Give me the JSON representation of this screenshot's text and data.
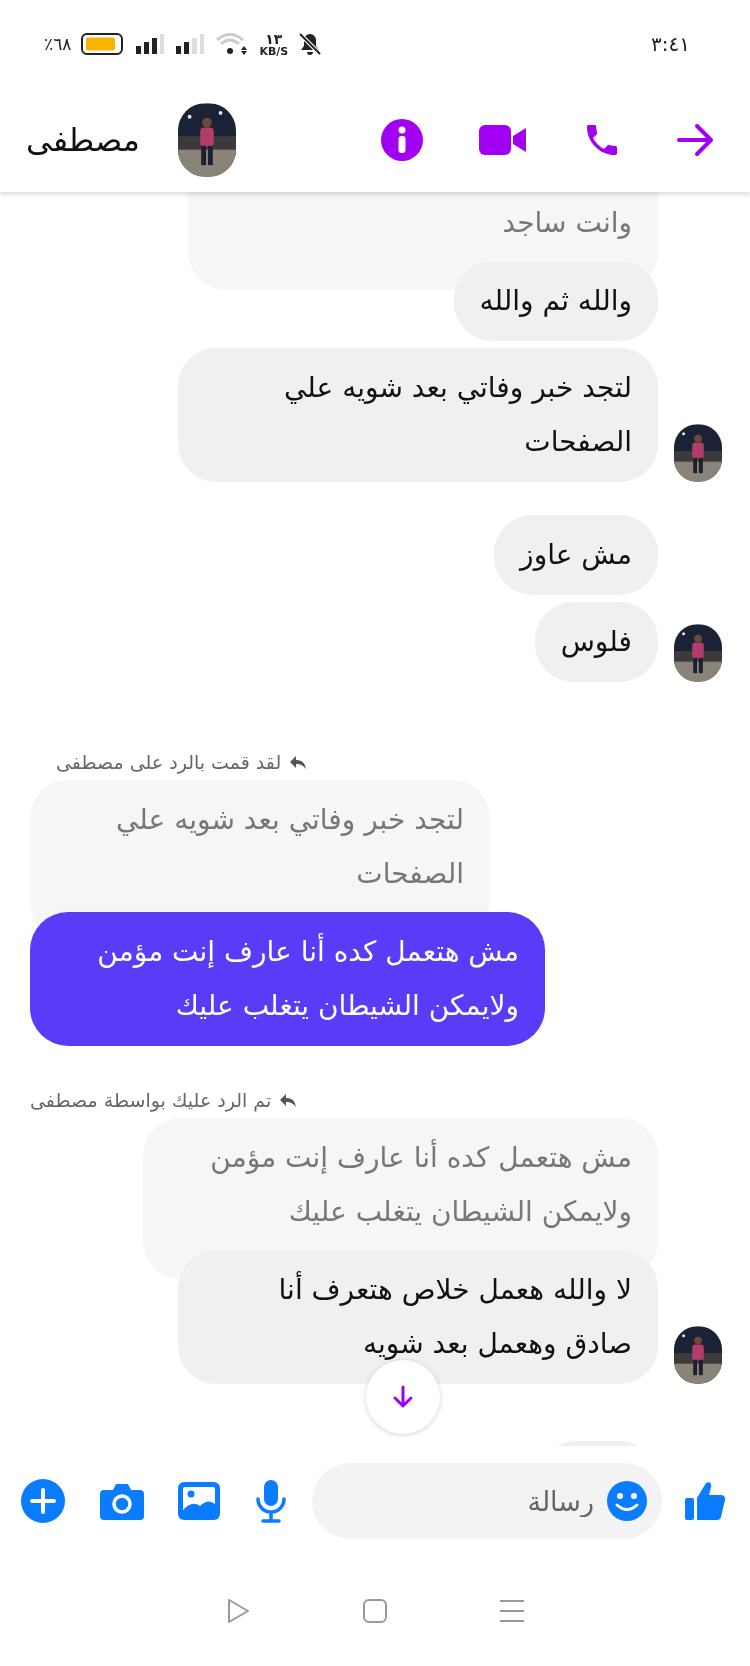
{
  "status_bar": {
    "time": "٣:٤١",
    "battery_text": "٪٦٨",
    "net_speed": "١٣",
    "net_unit": "KB/S"
  },
  "header": {
    "name": "مصطفى"
  },
  "messages": [
    {
      "kind": "quoted",
      "outgoing": false,
      "avatar": false,
      "text": "وانت ساجد"
    },
    {
      "kind": "message",
      "outgoing": false,
      "avatar": false,
      "text": "والله ثم والله"
    },
    {
      "kind": "message",
      "outgoing": false,
      "avatar": true,
      "text": "لتجد خبر وفاتي  بعد شويه علي الصفحات"
    },
    {
      "kind": "message",
      "outgoing": false,
      "avatar": false,
      "text": "مش عاوز"
    },
    {
      "kind": "message",
      "outgoing": false,
      "avatar": true,
      "text": "فلوس"
    },
    {
      "kind": "reply_label",
      "outgoing": true,
      "text": "لقد قمت بالرد على مصطفى"
    },
    {
      "kind": "quoted",
      "outgoing": true,
      "text": "لتجد خبر وفاتي  بعد شويه علي الصفحات"
    },
    {
      "kind": "message",
      "outgoing": true,
      "text": "مش هتعمل كده أنا عارف إنت مؤمن ولايمكن الشيطان يتغلب عليك"
    },
    {
      "kind": "reply_label",
      "outgoing": false,
      "text": "تم الرد عليك بواسطة مصطفى"
    },
    {
      "kind": "quoted",
      "outgoing": false,
      "avatar": false,
      "text": "مش هتعمل كده أنا عارف إنت مؤمن ولايمكن الشيطان يتغلب عليك"
    },
    {
      "kind": "message",
      "outgoing": false,
      "avatar": true,
      "text": "لا والله هعمل خلاص هتعرف أنا صادق وهعمل بعد شويه"
    },
    {
      "kind": "partial",
      "outgoing": false,
      "avatar": false
    }
  ],
  "composer": {
    "placeholder": "رسالة"
  }
}
